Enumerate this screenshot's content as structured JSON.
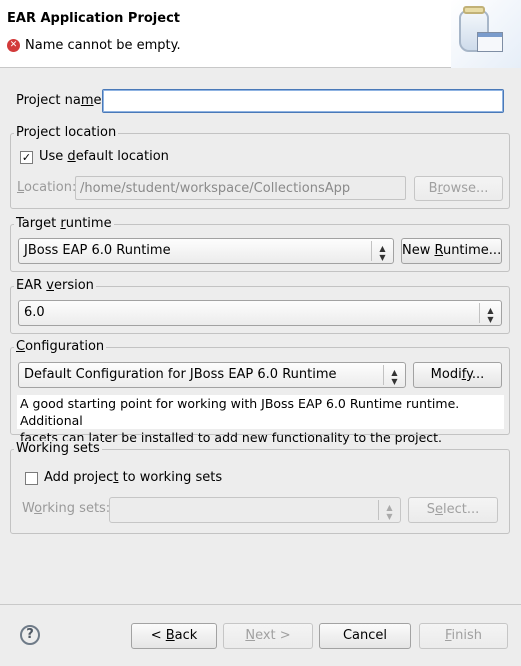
{
  "header": {
    "title": "EAR Application Project",
    "error_message": "Name cannot be empty."
  },
  "project_name": {
    "label_pre": "Project na",
    "label_mn": "m",
    "label_post": "e:",
    "value": ""
  },
  "project_location": {
    "group_title": "Project location",
    "use_default_pre": "Use ",
    "use_default_mn": "d",
    "use_default_post": "efault location",
    "use_default_checked": true,
    "location_label_mn": "L",
    "location_label_post": "ocation:",
    "location_value": "/home/student/workspace/CollectionsApp",
    "browse_pre": "B",
    "browse_mn": "r",
    "browse_post": "owse..."
  },
  "target_runtime": {
    "group_title_pre": "Target ",
    "group_title_mn": "r",
    "group_title_post": "untime",
    "selected": "JBoss EAP 6.0 Runtime",
    "new_runtime_pre": "New ",
    "new_runtime_mn": "R",
    "new_runtime_post": "untime..."
  },
  "ear_version": {
    "group_title_pre": "EAR ",
    "group_title_mn": "v",
    "group_title_post": "ersion",
    "selected": "6.0"
  },
  "configuration": {
    "group_title_mn": "C",
    "group_title_post": "onfiguration",
    "selected": "Default Configuration for JBoss EAP 6.0 Runtime",
    "modify_pre": "Modi",
    "modify_mn": "f",
    "modify_post": "y...",
    "description_line1": "A good starting point for working with JBoss EAP 6.0 Runtime runtime. Additional",
    "description_line2": "facets can later be installed to add new functionality to the project."
  },
  "working_sets": {
    "group_title": "Working sets",
    "add_pre": "Add projec",
    "add_mn": "t",
    "add_post": " to working sets",
    "add_checked": false,
    "sets_label_pre": "W",
    "sets_label_mn": "o",
    "sets_label_post": "rking sets:",
    "sets_value": "",
    "select_pre": "S",
    "select_mn": "e",
    "select_post": "lect..."
  },
  "footer": {
    "help": "?",
    "back_pre": "< ",
    "back_mn": "B",
    "back_post": "ack",
    "next_mn": "N",
    "next_post": "ext >",
    "cancel": "Cancel",
    "finish_mn": "F",
    "finish_post": "inish"
  },
  "icons": {
    "error": "error-icon",
    "checkbox_check": "✓",
    "combo_arrow": "updown-arrow-icon",
    "help": "help-icon",
    "wizard": "jar-wizard-banner-icon"
  }
}
